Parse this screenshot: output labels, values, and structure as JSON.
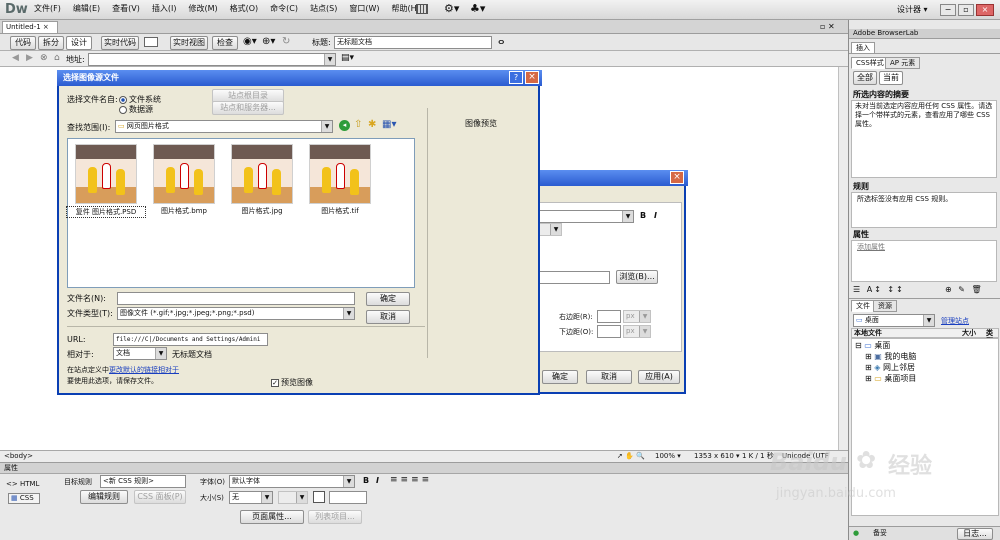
{
  "app": {
    "logo": "Dw",
    "menu": [
      "文件(F)",
      "编辑(E)",
      "查看(V)",
      "插入(I)",
      "修改(M)",
      "格式(O)",
      "命令(C)",
      "站点(S)",
      "窗口(W)",
      "帮助(H)"
    ],
    "workspace": "设计器",
    "doc_tab": "Untitled-1",
    "view_buttons": [
      "代码",
      "拆分",
      "设计",
      "实时代码",
      "实时视图",
      "检查"
    ],
    "title_label": "标题:",
    "title_value": "无标题文档",
    "address_label": "地址:"
  },
  "dialog": {
    "title": "选择图像源文件",
    "select_from_label": "选择文件名自:",
    "radio_filesystem": "文件系统",
    "radio_datasource": "数据源",
    "site_root_btn": "站点根目录",
    "site_server_btn": "站点和服务器...",
    "look_in_label": "查找范围(I):",
    "look_in_value": "网页图片格式",
    "preview_label": "图像预览",
    "files": [
      {
        "name": "复件 图片格式.PSD"
      },
      {
        "name": "图片格式.bmp"
      },
      {
        "name": "图片格式.jpg"
      },
      {
        "name": "图片格式.tif"
      }
    ],
    "filename_label": "文件名(N):",
    "filetype_label": "文件类型(T):",
    "filetype_value": "图像文件 (*.gif;*.jpg;*.jpeg;*.png;*.psd)",
    "ok_btn": "确定",
    "cancel_btn": "取消",
    "url_label": "URL:",
    "url_value": "file:///C|/Documents and Settings/Admini",
    "relative_label": "相对于:",
    "relative_value": "文档",
    "relative_doc": "无标题文档",
    "note_prefix": "在站点定义中",
    "note_link": "更改默认的链接相对于",
    "note2": "要使用此选项，请保存文件。",
    "preview_check": "预览图像"
  },
  "back_dialog": {
    "browse_btn": "浏览(B)...",
    "right_margin_label": "右边距(R):",
    "bottom_margin_label": "下边距(O):",
    "unit": "px",
    "ok_btn": "确定",
    "cancel_btn": "取消",
    "apply_btn": "应用(A)"
  },
  "status": {
    "tag": "<body>",
    "zoom": "100%",
    "dims": "1353 x 610",
    "size": "1 K / 1 秒",
    "encoding": "Unicode (UTF"
  },
  "props": {
    "header": "属性",
    "html_tab": "<> HTML",
    "css_tab": "CSS",
    "target_rule_label": "目标规则",
    "target_rule_value": "<新 CSS 规则>",
    "edit_rule_btn": "编辑规则",
    "css_panel_btn": "CSS 面板(P)",
    "font_label": "字体(O)",
    "font_value": "默认字体",
    "size_label": "大小(S)",
    "size_value": "无",
    "page_props_btn": "页面属性...",
    "list_items_btn": "列表项目..."
  },
  "right": {
    "browserlab": "Adobe BrowserLab",
    "insert_tab": "插入",
    "css_tab": "CSS样式",
    "ap_tab": "AP 元素",
    "all_btn": "全部",
    "current_btn": "当前",
    "summary_head": "所选内容的摘要",
    "summary_text": "未对当前选定内容应用任何 CSS 属性。请选择一个带样式的元素，查看应用了哪些 CSS 属性。",
    "rules_head": "规则",
    "rules_text": "所选标签没有应用 CSS 规则。",
    "props_head": "属性",
    "add_prop": "添加属性",
    "files_tab": "文件",
    "assets_tab": "资源",
    "location": "桌面",
    "manage_sites": "管理站点",
    "col_local": "本地文件",
    "col_size": "大小",
    "col_type": "类型",
    "tree": [
      "桌面",
      "我的电脑",
      "网上邻居",
      "桌面项目"
    ],
    "status_left": "备妥",
    "log_btn": "日志..."
  },
  "watermark": {
    "brand": "Baidu",
    "cn": "经验",
    "url": "jingyan.baidu.com"
  }
}
